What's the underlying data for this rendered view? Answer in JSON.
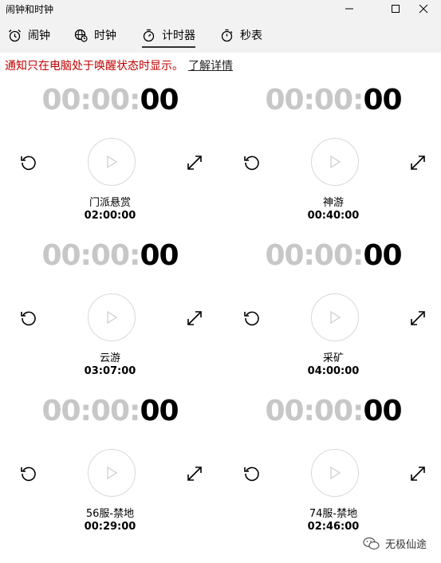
{
  "window": {
    "title": "闹钟和时钟"
  },
  "tabs": [
    {
      "label": "闹钟",
      "icon": "alarm-clock-icon"
    },
    {
      "label": "时钟",
      "icon": "world-clock-icon"
    },
    {
      "label": "计时器",
      "icon": "timer-icon",
      "selected": true
    },
    {
      "label": "秒表",
      "icon": "stopwatch-icon"
    }
  ],
  "notice": {
    "message": "通知只在电脑处于唤醒状态时显示。",
    "link": "了解详情"
  },
  "timers": [
    {
      "hm": "00:00:",
      "sec": "00",
      "name": "门派悬赏",
      "duration": "02:00:00"
    },
    {
      "hm": "00:00:",
      "sec": "00",
      "name": "神游",
      "duration": "00:40:00"
    },
    {
      "hm": "00:00:",
      "sec": "00",
      "name": "云游",
      "duration": "03:07:00"
    },
    {
      "hm": "00:00:",
      "sec": "00",
      "name": "采矿",
      "duration": "04:00:00"
    },
    {
      "hm": "00:00:",
      "sec": "00",
      "name": "56服-禁地",
      "duration": "00:29:00"
    },
    {
      "hm": "00:00:",
      "sec": "00",
      "name": "74服-禁地",
      "duration": "02:46:00"
    }
  ],
  "watermark": {
    "text": "无极仙途"
  },
  "colors": {
    "notice": "#c00000",
    "dim_digits": "#c7c7c7",
    "chrome": "#f2f2f2"
  }
}
